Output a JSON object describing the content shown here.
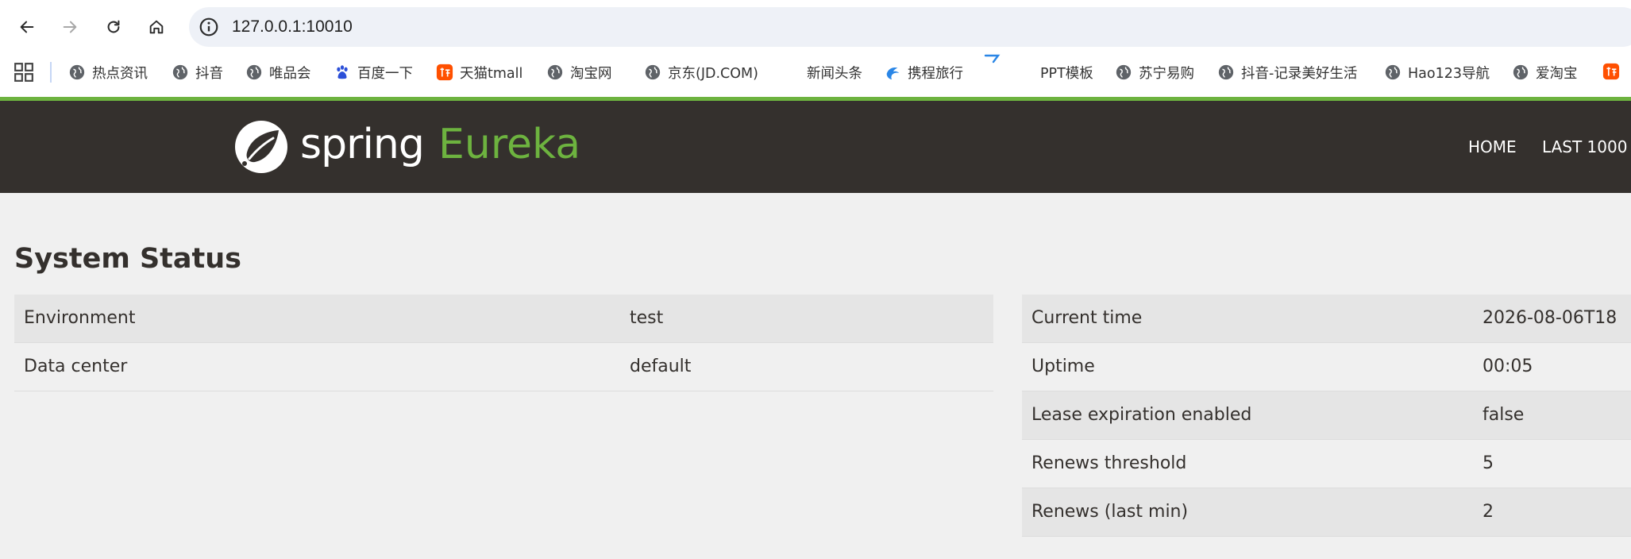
{
  "browser": {
    "url": "127.0.0.1:10010",
    "bookmarks": [
      "热点资讯",
      "抖音",
      "唯品会",
      "百度一下",
      "天猫tmall",
      "淘宝网",
      "京东(JD.COM)",
      "新闻头条",
      "携程旅行",
      "PPT模板",
      "苏宁易购",
      "抖音-记录美好生活",
      "Hao123导航",
      "爱淘宝"
    ]
  },
  "header": {
    "logo_spring": "spring",
    "logo_eureka": "Eureka",
    "nav": [
      "HOME",
      "LAST 1000"
    ]
  },
  "main": {
    "title": "System Status",
    "left_table": [
      {
        "label": "Environment",
        "value": "test"
      },
      {
        "label": "Data center",
        "value": "default"
      }
    ],
    "right_table": [
      {
        "label": "Current time",
        "value": "2026-08-06T18"
      },
      {
        "label": "Uptime",
        "value": "00:05"
      },
      {
        "label": "Lease expiration enabled",
        "value": "false"
      },
      {
        "label": "Renews threshold",
        "value": "5"
      },
      {
        "label": "Renews (last min)",
        "value": "2"
      }
    ]
  },
  "colors": {
    "header_bg": "#34302d",
    "accent_green": "#6db33f",
    "page_bg": "#f0f0f0",
    "row_shade": "#e5e5e5"
  }
}
